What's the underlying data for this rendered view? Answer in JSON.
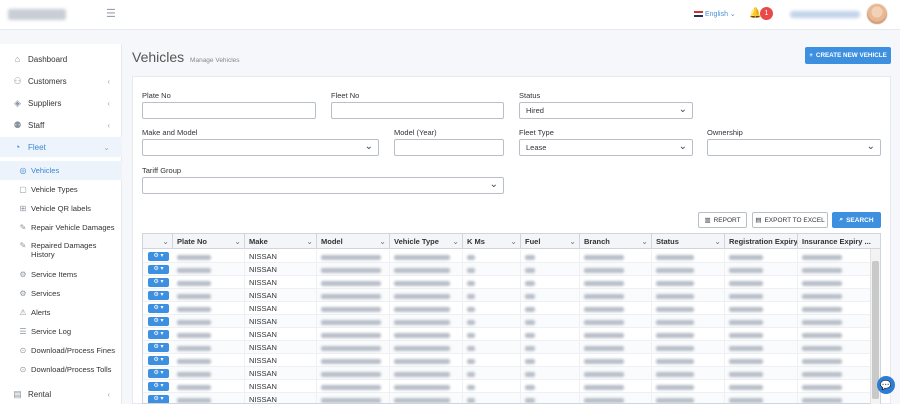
{
  "header": {
    "language": "English",
    "notifications_count": "1"
  },
  "sidebar": {
    "items": [
      {
        "label": "Dashboard",
        "icon": "home-icon"
      },
      {
        "label": "Customers",
        "icon": "users-icon"
      },
      {
        "label": "Suppliers",
        "icon": "layers-icon"
      },
      {
        "label": "Staff",
        "icon": "staff-icon"
      },
      {
        "label": "Fleet",
        "icon": "fleet-icon"
      }
    ],
    "fleet_subitems": [
      "Vehicles",
      "Vehicle Types",
      "Vehicle QR labels",
      "Repair Vehicle Damages",
      "Repaired Damages History",
      "Service Items",
      "Services",
      "Alerts",
      "Service Log",
      "Download/Process Fines",
      "Download/Process Tolls"
    ],
    "rental": "Rental"
  },
  "page": {
    "title": "Vehicles",
    "subtitle": "Manage Vehicles",
    "create_button": "CREATE NEW VEHICLE"
  },
  "filters": {
    "plate_no_label": "Plate No",
    "plate_no_value": "",
    "fleet_no_label": "Fleet No",
    "fleet_no_value": "",
    "status_label": "Status",
    "status_value": "Hired",
    "make_model_label": "Make and Model",
    "make_model_value": "",
    "model_year_label": "Model (Year)",
    "model_year_value": "",
    "fleet_type_label": "Fleet Type",
    "fleet_type_value": "Lease",
    "ownership_label": "Ownership",
    "ownership_value": "",
    "tariff_group_label": "Tariff Group",
    "tariff_group_value": ""
  },
  "actions": {
    "report": "REPORT",
    "export": "EXPORT TO EXCEL",
    "search": "SEARCH"
  },
  "table": {
    "columns": [
      "Plate No",
      "Make",
      "Model",
      "Vehicle Type",
      "K Ms",
      "Fuel",
      "Branch",
      "Status",
      "Registration Expiry",
      "Insurance Expiry ..."
    ],
    "rows": [
      "NISSAN",
      "NISSAN",
      "NISSAN",
      "NISSAN",
      "NISSAN",
      "NISSAN",
      "NISSAN",
      "NISSAN",
      "NISSAN",
      "NISSAN",
      "NISSAN",
      "NISSAN"
    ]
  },
  "colors": {
    "accent": "#3d8fe0",
    "badge": "#e84a4a"
  }
}
